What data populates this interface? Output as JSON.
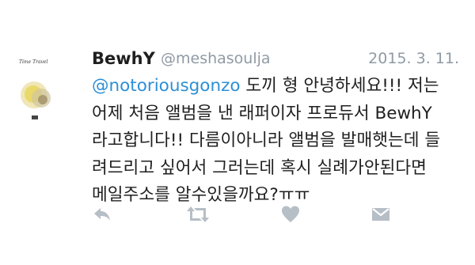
{
  "tweet": {
    "author_name": "BewhY",
    "author_handle": "@meshasoulja",
    "date": "2015. 3. 11.",
    "mention": "@notoriousgonzo",
    "line1_rest": " 도끼 형 안녕하세요!!! 저는",
    "line2": "어제 처음 앨범을 낸 래퍼이자 프로듀서 BewhY",
    "line3": "라고합니다!! 다름이아니라 앨범을 발매햇는데 들",
    "line4": "려드리고 싶어서 그러는데 혹시 실례가안된다면",
    "line5": "메일주소를 알수있을까요?ㅠㅠ",
    "avatar_logo_text": "Time Travel"
  },
  "actions": [
    {
      "icon": "reply-icon"
    },
    {
      "icon": "retweet-icon"
    },
    {
      "icon": "like-heart-icon"
    },
    {
      "icon": "direct-message-icon"
    }
  ],
  "colors": {
    "mention": "#2c8fd6",
    "meta": "#8f9aa4",
    "icons": "#b6bec6",
    "text": "#1f1f1f"
  }
}
